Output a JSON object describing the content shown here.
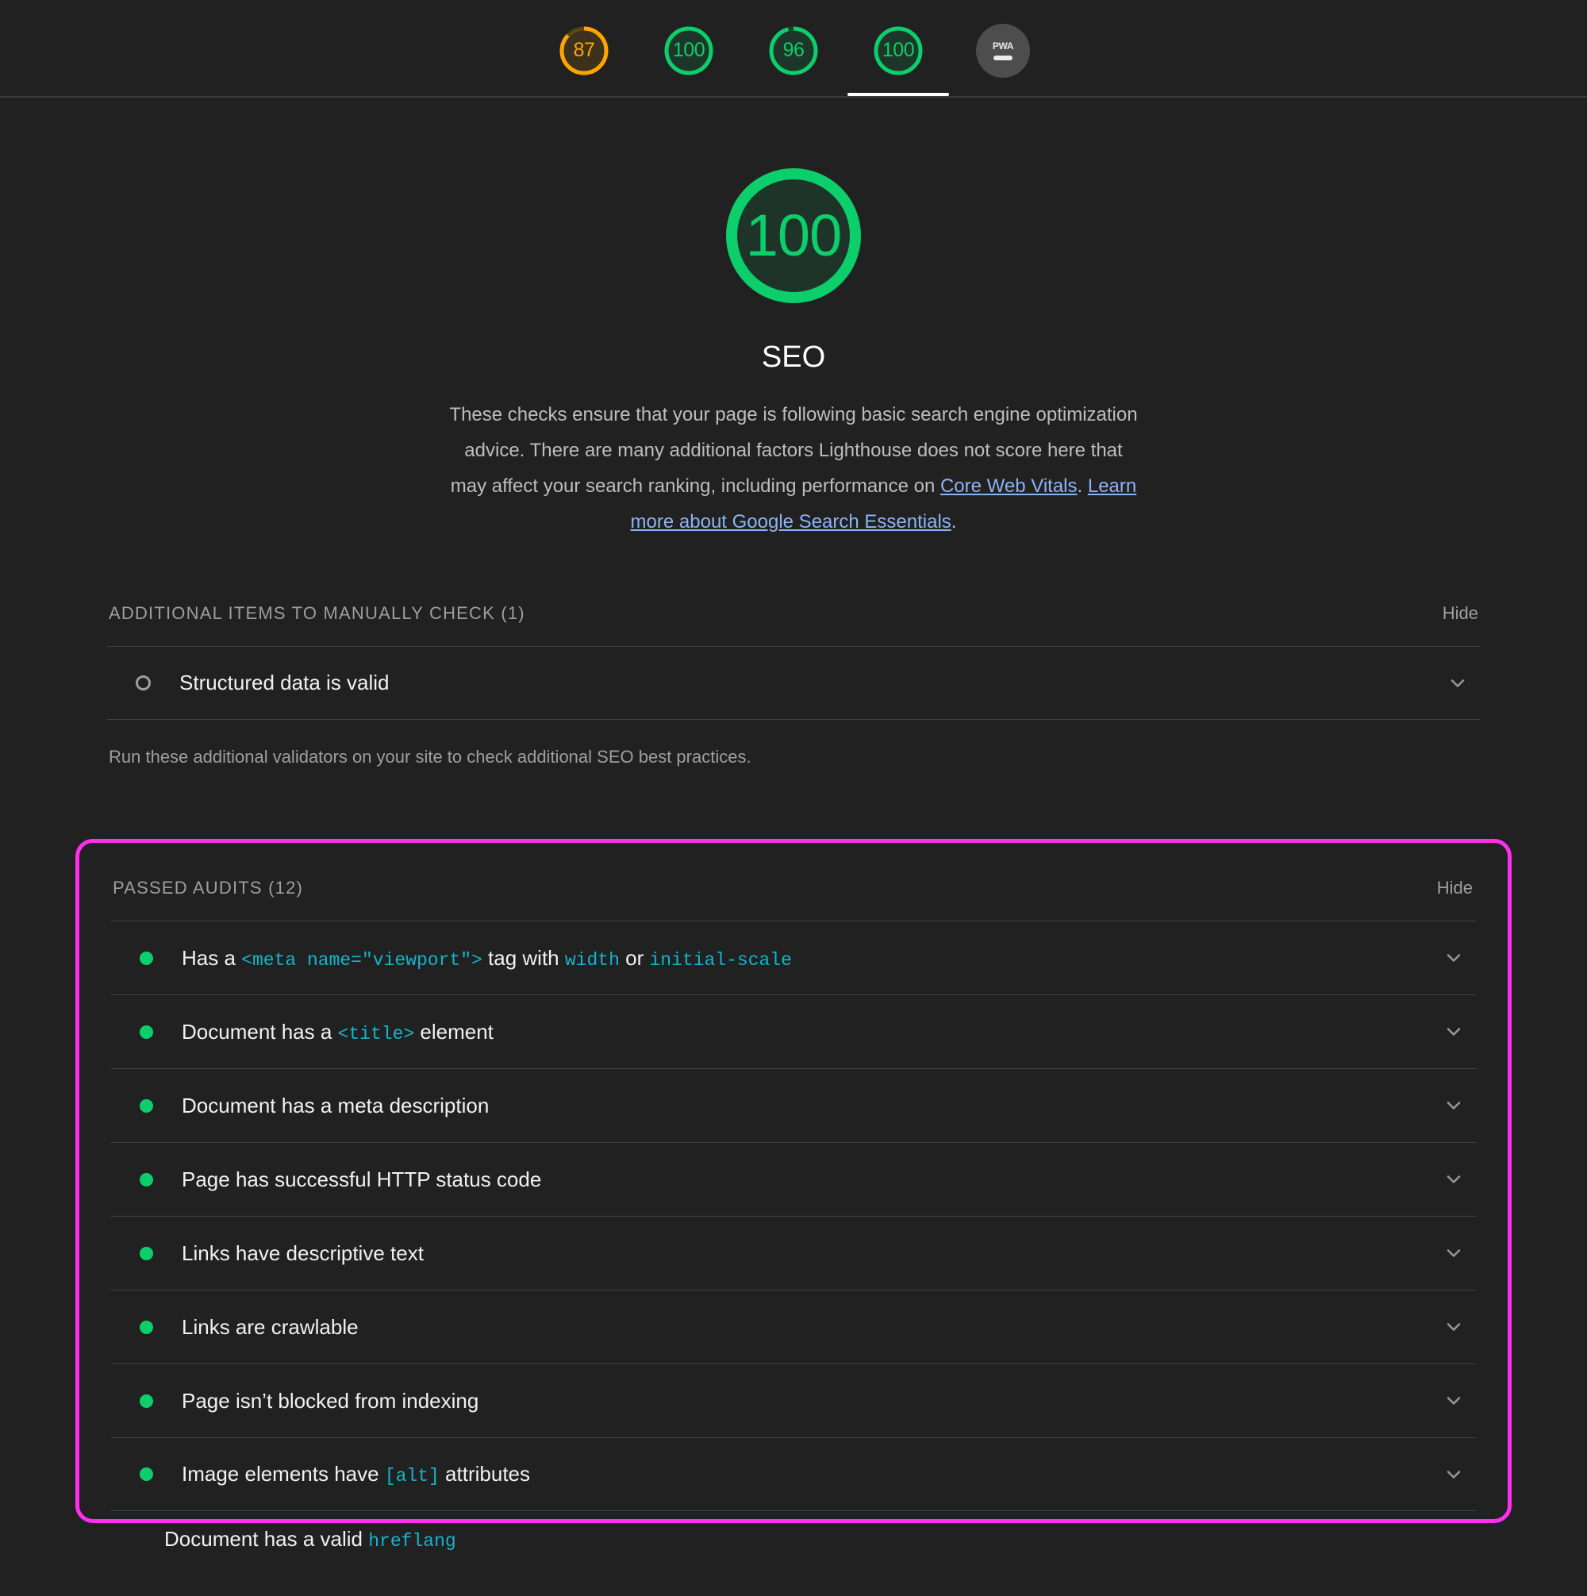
{
  "topbar": {
    "gauges": [
      {
        "name": "performance",
        "score": "87",
        "color": "#ffa400",
        "track": "#ffa40033",
        "dash_pct": 87
      },
      {
        "name": "accessibility",
        "score": "100",
        "color": "#0cce6b",
        "track": "#0cce6b26",
        "dash_pct": 100
      },
      {
        "name": "best-practices",
        "score": "96",
        "color": "#0cce6b",
        "track": "#0cce6b26",
        "dash_pct": 96
      },
      {
        "name": "seo",
        "score": "100",
        "color": "#0cce6b",
        "track": "#0cce6b26",
        "dash_pct": 100
      }
    ],
    "pwa": {
      "label": "PWA",
      "icon": "dash-icon"
    }
  },
  "hero": {
    "score": "100",
    "score_color": "#0cce6b",
    "title": "SEO",
    "description_part1": "These checks ensure that your page is following basic search engine optimization advice. There are many additional factors Lighthouse does not score here that may affect your search ranking, including performance on ",
    "link1": "Core Web Vitals",
    "description_part2": ". ",
    "link2": "Learn more about Google Search Essentials",
    "description_part3": "."
  },
  "manual_section": {
    "title": "ADDITIONAL ITEMS TO MANUALLY CHECK (1)",
    "hide_label": "Hide",
    "items": [
      {
        "title": "Structured data is valid",
        "status": "manual"
      }
    ],
    "note": "Run these additional validators on your site to check additional SEO best practices."
  },
  "passed_section": {
    "title": "PASSED AUDITS (12)",
    "hide_label": "Hide",
    "highlight_color": "#ff2ff0",
    "items": [
      {
        "prefix": "Has a ",
        "code1": "<meta name=\"viewport\">",
        "mid1": " tag with ",
        "code2": "width",
        "mid2": " or ",
        "code3": "initial-scale",
        "suffix": ""
      },
      {
        "prefix": "Document has a ",
        "code1": "<title>",
        "mid1": " element",
        "code2": "",
        "mid2": "",
        "code3": "",
        "suffix": ""
      },
      {
        "prefix": "Document has a meta description",
        "code1": "",
        "mid1": "",
        "code2": "",
        "mid2": "",
        "code3": "",
        "suffix": ""
      },
      {
        "prefix": "Page has successful HTTP status code",
        "code1": "",
        "mid1": "",
        "code2": "",
        "mid2": "",
        "code3": "",
        "suffix": ""
      },
      {
        "prefix": "Links have descriptive text",
        "code1": "",
        "mid1": "",
        "code2": "",
        "mid2": "",
        "code3": "",
        "suffix": ""
      },
      {
        "prefix": "Links are crawlable",
        "code1": "",
        "mid1": "",
        "code2": "",
        "mid2": "",
        "code3": "",
        "suffix": ""
      },
      {
        "prefix": "Page isn’t blocked from indexing",
        "code1": "",
        "mid1": "",
        "code2": "",
        "mid2": "",
        "code3": "",
        "suffix": ""
      },
      {
        "prefix": "Image elements have ",
        "code1": "[alt]",
        "mid1": " attributes",
        "code2": "",
        "mid2": "",
        "code3": "",
        "suffix": ""
      }
    ],
    "partial_item": {
      "prefix": "Document has a valid ",
      "code1": "hreflang",
      "mid1": "",
      "code2": "",
      "mid2": "",
      "code3": "",
      "suffix": ""
    }
  }
}
